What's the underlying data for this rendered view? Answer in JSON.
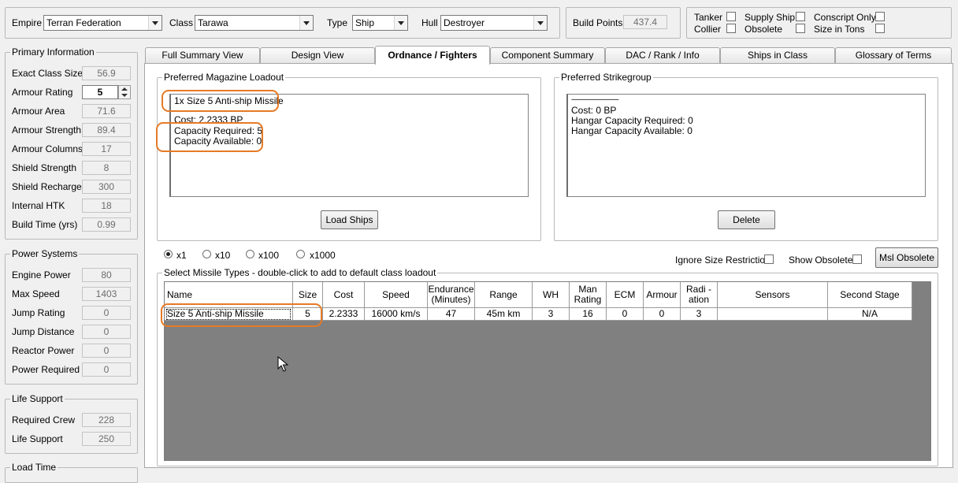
{
  "header": {
    "empire": {
      "label": "Empire",
      "value": "Terran Federation"
    },
    "class": {
      "label": "Class",
      "value": "Tarawa"
    },
    "type": {
      "label": "Type",
      "value": "Ship"
    },
    "hull": {
      "label": "Hull",
      "value": "Destroyer"
    },
    "build_points": {
      "label": "Build Points",
      "value": "437.4"
    },
    "checkboxes": {
      "tanker": "Tanker",
      "supply_ship": "Supply Ship",
      "conscript_only": "Conscript Only",
      "collier": "Collier",
      "obsolete": "Obsolete",
      "size_in_tons": "Size in Tons"
    }
  },
  "primary": {
    "title": "Primary Information",
    "rows": [
      {
        "label": "Exact Class Size",
        "value": "56.9"
      },
      {
        "label": "Armour Rating",
        "value": "5"
      },
      {
        "label": "Armour Area",
        "value": "71.6"
      },
      {
        "label": "Armour Strength",
        "value": "89.4"
      },
      {
        "label": "Armour Columns",
        "value": "17"
      },
      {
        "label": "Shield Strength",
        "value": "8"
      },
      {
        "label": "Shield Recharge",
        "value": "300"
      },
      {
        "label": "Internal HTK",
        "value": "18"
      },
      {
        "label": "Build Time (yrs)",
        "value": "0.99"
      }
    ]
  },
  "power": {
    "title": "Power Systems",
    "rows": [
      {
        "label": "Engine Power",
        "value": "80"
      },
      {
        "label": "Max Speed",
        "value": "1403"
      },
      {
        "label": "Jump Rating",
        "value": "0"
      },
      {
        "label": "Jump Distance",
        "value": "0"
      },
      {
        "label": "Reactor Power",
        "value": "0"
      },
      {
        "label": "Power Required",
        "value": "0"
      }
    ]
  },
  "life": {
    "title": "Life Support",
    "rows": [
      {
        "label": "Required Crew",
        "value": "228"
      },
      {
        "label": "Life Support",
        "value": "250"
      }
    ]
  },
  "load_time": {
    "title": "Load Time"
  },
  "tabs": [
    "Full Summary View",
    "Design View",
    "Ordnance / Fighters",
    "Component Summary",
    "DAC / Rank / Info",
    "Ships in Class",
    "Glossary of Terms"
  ],
  "magazine": {
    "title": "Preferred Magazine Loadout",
    "lines": [
      "1x Size 5 Anti-ship Missile",
      "",
      "Cost: 2.2333 BP",
      "Capacity Required: 5",
      "Capacity Available: 0"
    ],
    "button": "Load Ships"
  },
  "strikegroup": {
    "title": "Preferred Strikegroup",
    "lines": [
      "------------------------------",
      "Cost: 0 BP",
      "Hangar Capacity Required: 0",
      "Hangar Capacity Available: 0"
    ],
    "button": "Delete"
  },
  "multipliers": [
    "x1",
    "x10",
    "x100",
    "x1000"
  ],
  "options": {
    "ignore_size": "Ignore Size Restriction",
    "show_obsolete": "Show Obsolete",
    "msl_obsolete": "Msl Obsolete"
  },
  "missiles": {
    "title": "Select Missile Types - double-click to add to default class loadout",
    "columns": [
      "Name",
      "Size",
      "Cost",
      "Speed",
      "Endurance (Minutes)",
      "Range",
      "WH",
      "Man Rating",
      "ECM",
      "Armour",
      "Radi -ation",
      "Sensors",
      "Second Stage"
    ],
    "rows": [
      [
        "Size 5 Anti-ship Missile",
        "5",
        "2.2333",
        "16000 km/s",
        "47",
        "45m km",
        "3",
        "16",
        "0",
        "0",
        "3",
        "",
        "N/A"
      ]
    ]
  },
  "colors": {
    "highlight": "#e57a26",
    "grid_background": "#808080"
  }
}
